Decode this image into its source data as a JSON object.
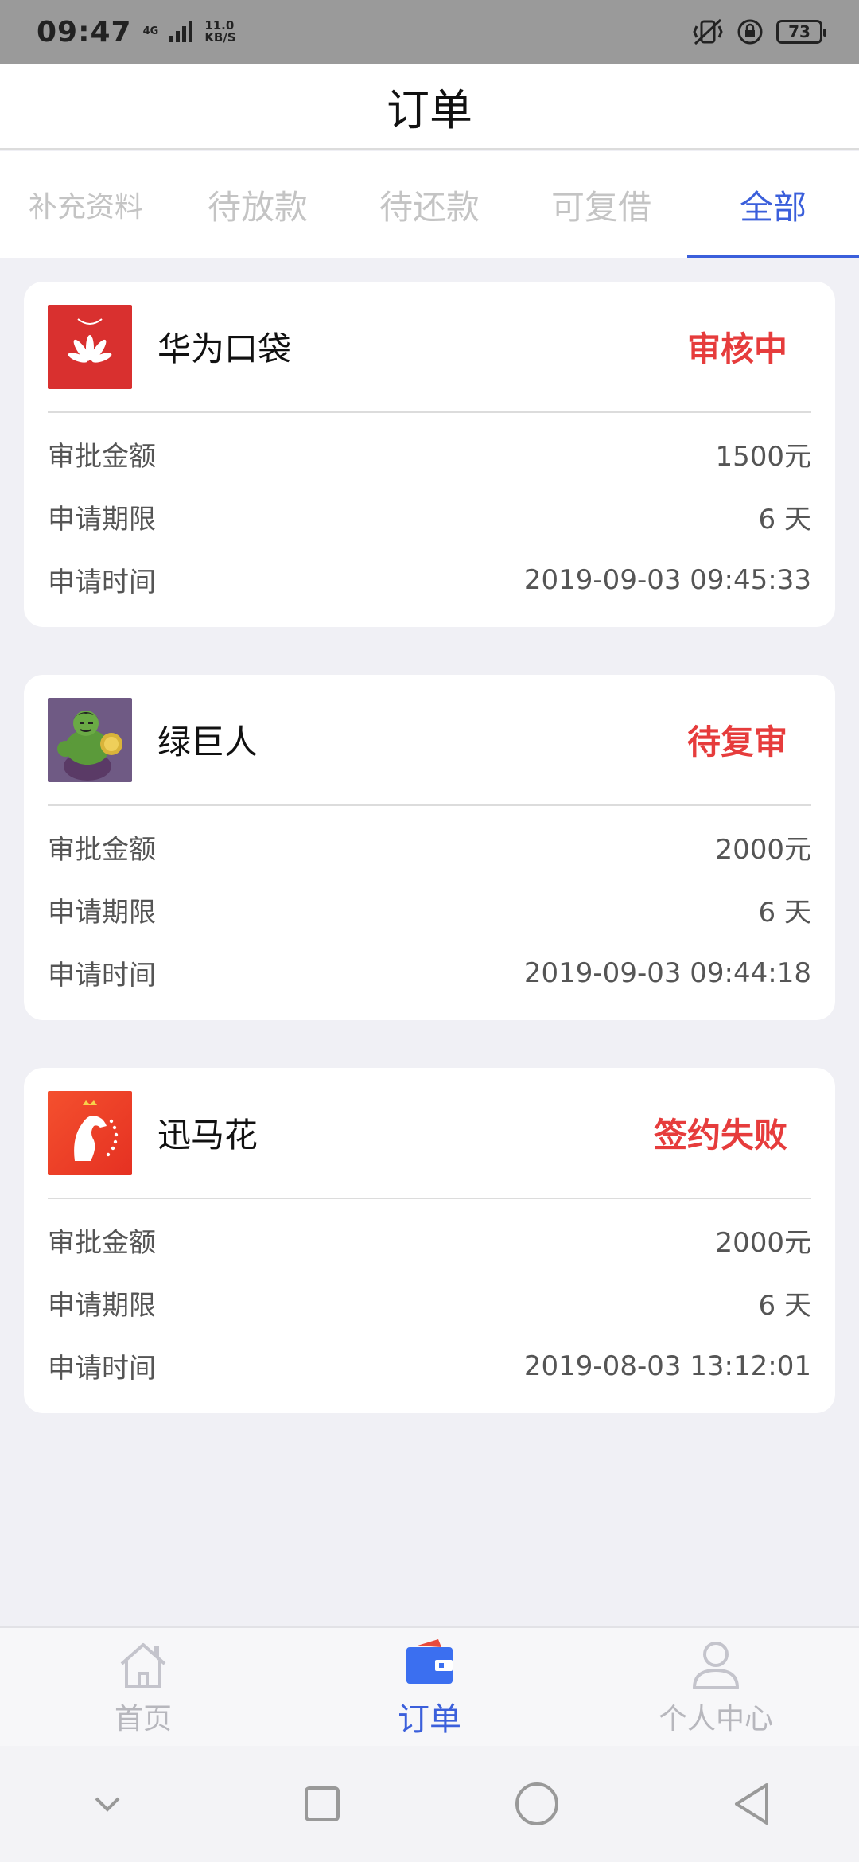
{
  "status_bar": {
    "time": "09:47",
    "network": "4G",
    "speed_value": "11.0",
    "speed_unit": "KB/S",
    "battery": "73"
  },
  "header": {
    "title": "订单"
  },
  "tabs": [
    {
      "label": "补充资料",
      "active": false
    },
    {
      "label": "待放款",
      "active": false
    },
    {
      "label": "待还款",
      "active": false
    },
    {
      "label": "可复借",
      "active": false
    },
    {
      "label": "全部",
      "active": true
    }
  ],
  "orders": [
    {
      "name": "华为口袋",
      "status": "审核中",
      "logo": "huawei-logo",
      "rows": [
        {
          "label": "审批金额",
          "value": "1500元"
        },
        {
          "label": "申请期限",
          "value": "6 天"
        },
        {
          "label": "申请时间",
          "value": "2019-09-03 09:45:33"
        }
      ]
    },
    {
      "name": "绿巨人",
      "status": "待复审",
      "logo": "hulk-logo",
      "rows": [
        {
          "label": "审批金额",
          "value": "2000元"
        },
        {
          "label": "申请期限",
          "value": "6 天"
        },
        {
          "label": "申请时间",
          "value": "2019-09-03 09:44:18"
        }
      ]
    },
    {
      "name": "迅马花",
      "status": "签约失败",
      "logo": "horse-logo",
      "rows": [
        {
          "label": "审批金额",
          "value": "2000元"
        },
        {
          "label": "申请期限",
          "value": "6 天"
        },
        {
          "label": "申请时间",
          "value": "2019-08-03 13:12:01"
        }
      ]
    }
  ],
  "bottom_nav": [
    {
      "label": "首页",
      "icon": "home-icon",
      "active": false
    },
    {
      "label": "订单",
      "icon": "wallet-icon",
      "active": true
    },
    {
      "label": "个人中心",
      "icon": "user-icon",
      "active": false
    }
  ],
  "colors": {
    "accent": "#3b5fdb",
    "status_red": "#e63c3c",
    "inactive_tab": "#c4c4c4",
    "background": "#f0f0f5"
  }
}
